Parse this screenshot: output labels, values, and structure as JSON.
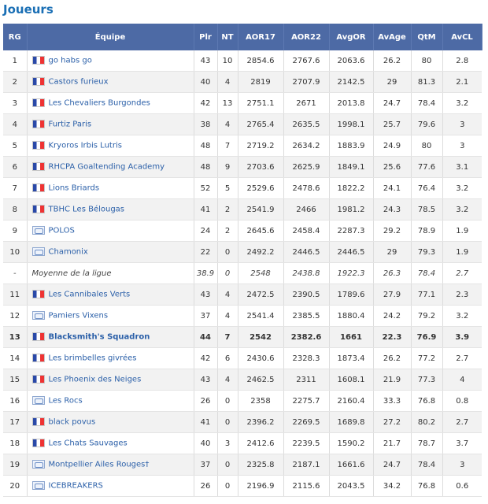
{
  "title": "Joueurs",
  "headers": {
    "rg": "RG",
    "equipe": "Équipe",
    "plr": "Plr",
    "nt": "NT",
    "aor17": "AOR17",
    "aor22": "AOR22",
    "avgor": "AvgOR",
    "avage": "AvAge",
    "qtm": "QtM",
    "avcl": "AvCL"
  },
  "rows": [
    {
      "rg": "1",
      "team": "go habs go",
      "flag": "fr",
      "plr": "43",
      "nt": "10",
      "aor17": "2854.6",
      "aor22": "2767.6",
      "avgor": "2063.6",
      "avage": "26.2",
      "qtm": "80",
      "avcl": "2.8"
    },
    {
      "rg": "2",
      "team": "Castors furieux",
      "flag": "fr",
      "plr": "40",
      "nt": "4",
      "aor17": "2819",
      "aor22": "2707.9",
      "avgor": "2142.5",
      "avage": "29",
      "qtm": "81.3",
      "avcl": "2.1"
    },
    {
      "rg": "3",
      "team": "Les Chevaliers Burgondes",
      "flag": "fr",
      "plr": "42",
      "nt": "13",
      "aor17": "2751.1",
      "aor22": "2671",
      "avgor": "2013.8",
      "avage": "24.7",
      "qtm": "78.4",
      "avcl": "3.2"
    },
    {
      "rg": "4",
      "team": "Furtiz Paris",
      "flag": "fr",
      "plr": "38",
      "nt": "4",
      "aor17": "2765.4",
      "aor22": "2635.5",
      "avgor": "1998.1",
      "avage": "25.7",
      "qtm": "79.6",
      "avcl": "3"
    },
    {
      "rg": "5",
      "team": "Kryoros Irbis Lutris",
      "flag": "fr",
      "plr": "48",
      "nt": "7",
      "aor17": "2719.2",
      "aor22": "2634.2",
      "avgor": "1883.9",
      "avage": "24.9",
      "qtm": "80",
      "avcl": "3"
    },
    {
      "rg": "6",
      "team": "RHCPA Goaltending Academy",
      "flag": "fr",
      "plr": "48",
      "nt": "9",
      "aor17": "2703.6",
      "aor22": "2625.9",
      "avgor": "1849.1",
      "avage": "25.6",
      "qtm": "77.6",
      "avcl": "3.1"
    },
    {
      "rg": "7",
      "team": "Lions Briards",
      "flag": "fr",
      "plr": "52",
      "nt": "5",
      "aor17": "2529.6",
      "aor22": "2478.6",
      "avgor": "1822.2",
      "avage": "24.1",
      "qtm": "76.4",
      "avcl": "3.2"
    },
    {
      "rg": "8",
      "team": "TBHC Les Bélougas",
      "flag": "fr",
      "plr": "41",
      "nt": "2",
      "aor17": "2541.9",
      "aor22": "2466",
      "avgor": "1981.2",
      "avage": "24.3",
      "qtm": "78.5",
      "avcl": "3.2"
    },
    {
      "rg": "9",
      "team": "POLOS",
      "flag": "gen",
      "plr": "24",
      "nt": "2",
      "aor17": "2645.6",
      "aor22": "2458.4",
      "avgor": "2287.3",
      "avage": "29.2",
      "qtm": "78.9",
      "avcl": "1.9"
    },
    {
      "rg": "10",
      "team": "Chamonix",
      "flag": "gen",
      "plr": "22",
      "nt": "0",
      "aor17": "2492.2",
      "aor22": "2446.5",
      "avgor": "2446.5",
      "avage": "29",
      "qtm": "79.3",
      "avcl": "1.9"
    },
    {
      "rg": "-",
      "team": "Moyenne de la ligue",
      "flag": "",
      "avg": true,
      "plr": "38.9",
      "nt": "0",
      "aor17": "2548",
      "aor22": "2438.8",
      "avgor": "1922.3",
      "avage": "26.3",
      "qtm": "78.4",
      "avcl": "2.7"
    },
    {
      "rg": "11",
      "team": "Les Cannibales Verts",
      "flag": "fr",
      "plr": "43",
      "nt": "4",
      "aor17": "2472.5",
      "aor22": "2390.5",
      "avgor": "1789.6",
      "avage": "27.9",
      "qtm": "77.1",
      "avcl": "2.3"
    },
    {
      "rg": "12",
      "team": "Pamiers Vixens",
      "flag": "gen",
      "plr": "37",
      "nt": "4",
      "aor17": "2541.4",
      "aor22": "2385.5",
      "avgor": "1880.4",
      "avage": "24.2",
      "qtm": "79.2",
      "avcl": "3.2"
    },
    {
      "rg": "13",
      "team": "Blacksmith's Squadron",
      "flag": "fr",
      "hl": true,
      "plr": "44",
      "nt": "7",
      "aor17": "2542",
      "aor22": "2382.6",
      "avgor": "1661",
      "avage": "22.3",
      "qtm": "76.9",
      "avcl": "3.9"
    },
    {
      "rg": "14",
      "team": "Les brimbelles givrées",
      "flag": "fr",
      "plr": "42",
      "nt": "6",
      "aor17": "2430.6",
      "aor22": "2328.3",
      "avgor": "1873.4",
      "avage": "26.2",
      "qtm": "77.2",
      "avcl": "2.7"
    },
    {
      "rg": "15",
      "team": "Les Phoenix des Neiges",
      "flag": "fr",
      "plr": "43",
      "nt": "4",
      "aor17": "2462.5",
      "aor22": "2311",
      "avgor": "1608.1",
      "avage": "21.9",
      "qtm": "77.3",
      "avcl": "4"
    },
    {
      "rg": "16",
      "team": "Les Rocs",
      "flag": "gen",
      "plr": "26",
      "nt": "0",
      "aor17": "2358",
      "aor22": "2275.7",
      "avgor": "2160.4",
      "avage": "33.3",
      "qtm": "76.8",
      "avcl": "0.8"
    },
    {
      "rg": "17",
      "team": "black povus",
      "flag": "fr",
      "plr": "41",
      "nt": "0",
      "aor17": "2396.2",
      "aor22": "2269.5",
      "avgor": "1689.8",
      "avage": "27.2",
      "qtm": "80.2",
      "avcl": "2.7"
    },
    {
      "rg": "18",
      "team": "Les Chats Sauvages",
      "flag": "fr",
      "plr": "40",
      "nt": "3",
      "aor17": "2412.6",
      "aor22": "2239.5",
      "avgor": "1590.2",
      "avage": "21.7",
      "qtm": "78.7",
      "avcl": "3.7"
    },
    {
      "rg": "19",
      "team": "Montpellier Ailes Rouges†",
      "flag": "gen",
      "plr": "37",
      "nt": "0",
      "aor17": "2325.8",
      "aor22": "2187.1",
      "avgor": "1661.6",
      "avage": "24.7",
      "qtm": "78.4",
      "avcl": "3"
    },
    {
      "rg": "20",
      "team": "ICEBREAKERS",
      "flag": "gen",
      "plr": "26",
      "nt": "0",
      "aor17": "2196.9",
      "aor22": "2115.6",
      "avgor": "2043.5",
      "avage": "34.2",
      "qtm": "76.8",
      "avcl": "0.6"
    }
  ]
}
